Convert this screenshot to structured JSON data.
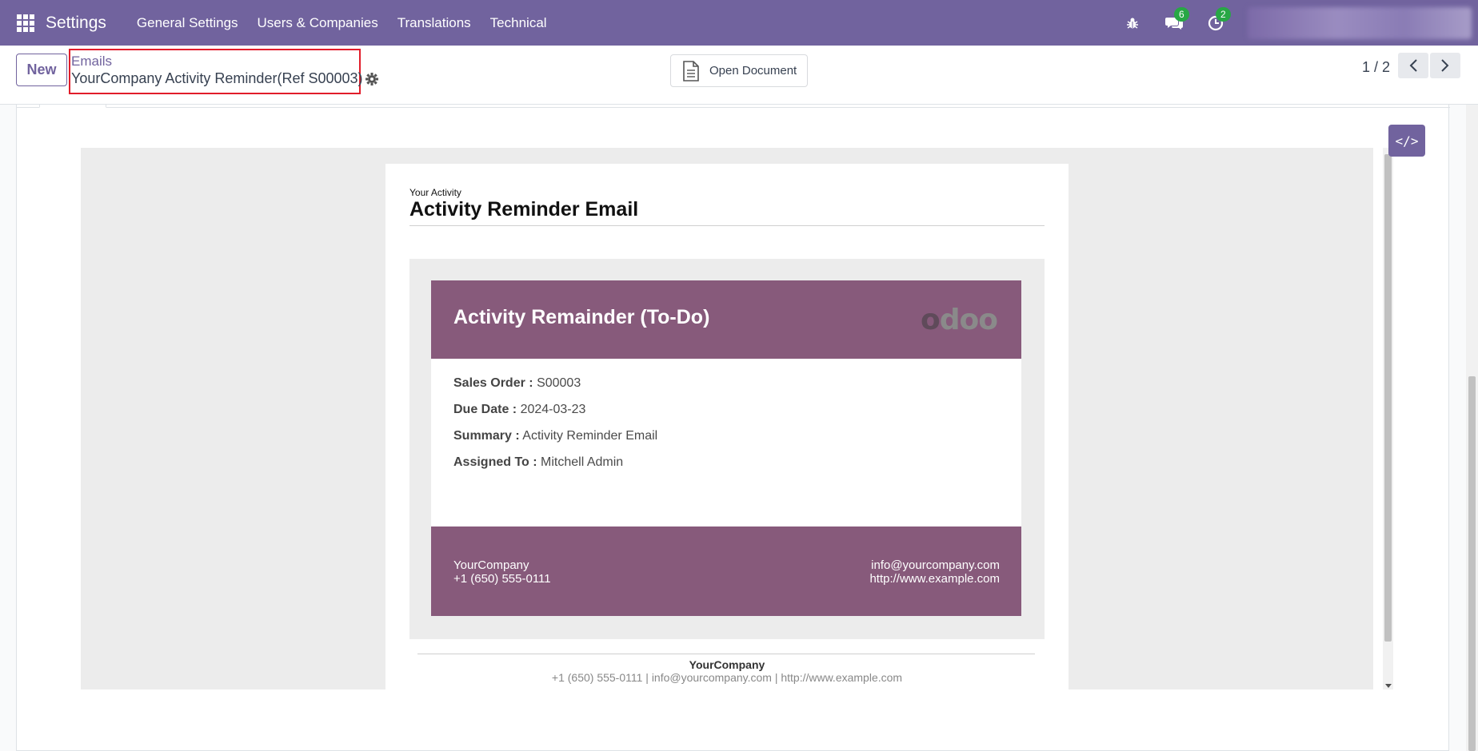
{
  "navbar": {
    "app_name": "Settings",
    "menu": [
      "General Settings",
      "Users & Companies",
      "Translations",
      "Technical"
    ],
    "chat_count": "6",
    "activity_count": "2"
  },
  "control": {
    "new_label": "New",
    "breadcrumb_parent": "Emails",
    "breadcrumb_current": "YourCompany Activity Reminder(Ref S00003)",
    "open_document_label": "Open Document",
    "pager": "1 / 2"
  },
  "email": {
    "subtitle": "Your Activity",
    "heading": "Activity Reminder Email",
    "card_title": "Activity Remainder (To-Do)",
    "logo_text": "odoo",
    "fields": [
      {
        "label": "Sales Order :",
        "value": "S00003"
      },
      {
        "label": "Due Date :",
        "value": "2024-03-23"
      },
      {
        "label": "Summary :",
        "value": "Activity Reminder Email"
      },
      {
        "label": "Assigned To :",
        "value": "Mitchell Admin"
      }
    ],
    "footer_company": "YourCompany",
    "footer_phone": "+1 (650) 555-0111",
    "footer_email": "info@yourcompany.com",
    "footer_website": "http://www.example.com",
    "bottom_company": "YourCompany",
    "bottom_contact": "+1 (650) 555-0111 | info@yourcompany.com | http://www.example.com"
  },
  "colors": {
    "brand": "#71639e",
    "email_accent": "#875a7b",
    "highlight": "#e11d2a"
  },
  "icons": {
    "apps": "apps-grid-icon",
    "debug": "bug-icon",
    "chat": "chat-icon",
    "activity": "clock-icon",
    "settings": "gear-icon",
    "document": "document-icon",
    "code": "code-icon"
  }
}
